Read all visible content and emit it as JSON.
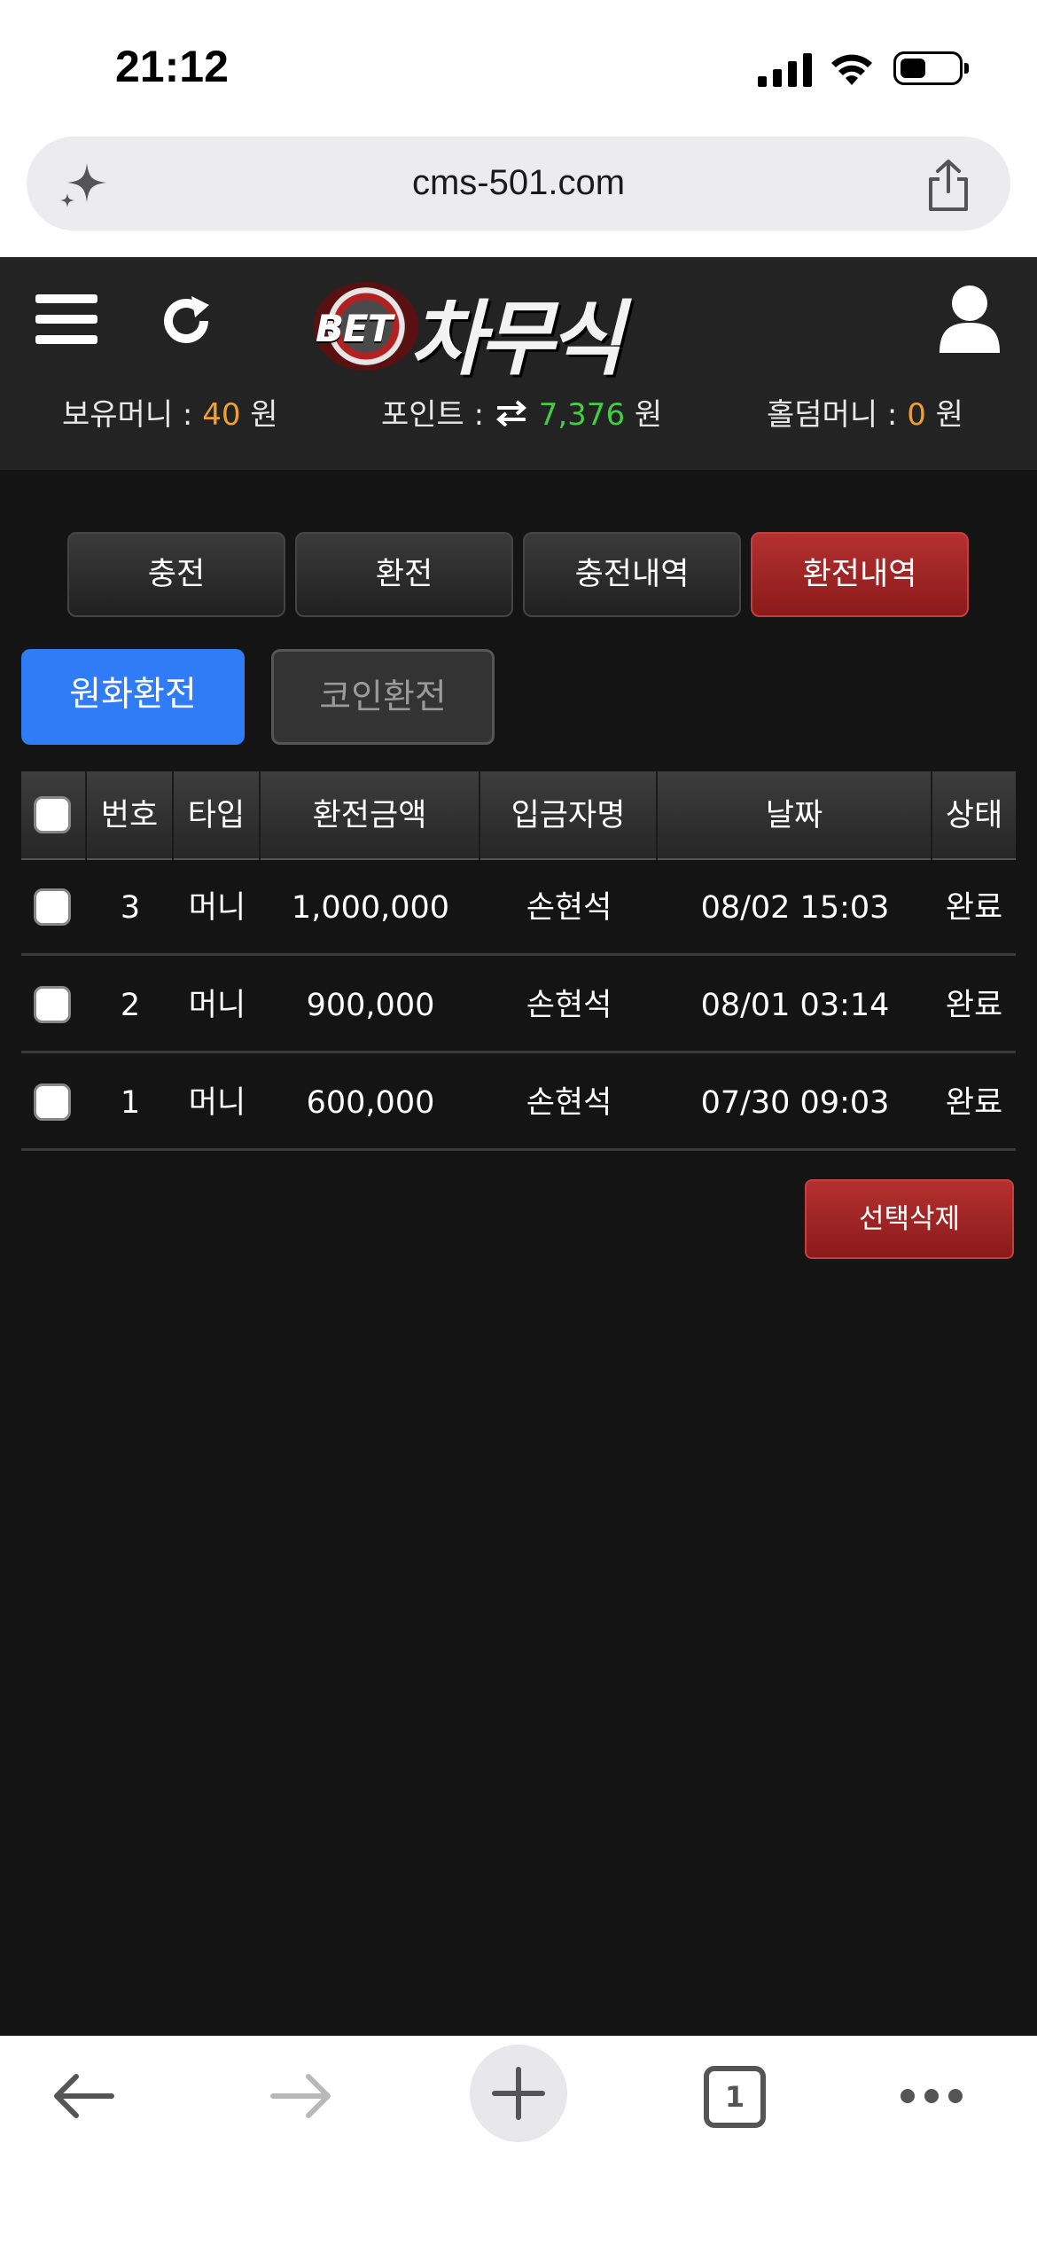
{
  "status_bar": {
    "time": "21:12"
  },
  "browser": {
    "url": "cms-501.com"
  },
  "header": {
    "logo_prefix": "BET",
    "logo_name": "차무식",
    "balances": {
      "money_label": "보유머니 :",
      "money_value": "40",
      "money_unit": "원",
      "point_label": "포인트 :",
      "point_value": "7,376",
      "point_unit": "원",
      "holdem_label": "홀덤머니 :",
      "holdem_value": "0",
      "holdem_unit": "원"
    }
  },
  "tabs": [
    {
      "label": "충전",
      "active": false
    },
    {
      "label": "환전",
      "active": false
    },
    {
      "label": "충전내역",
      "active": false
    },
    {
      "label": "환전내역",
      "active": true
    }
  ],
  "subtabs": [
    {
      "label": "원화환전",
      "selected": true
    },
    {
      "label": "코인환전",
      "selected": false
    }
  ],
  "table": {
    "columns": [
      "번호",
      "타입",
      "환전금액",
      "입금자명",
      "날짜",
      "상태"
    ],
    "rows": [
      {
        "no": "3",
        "type": "머니",
        "amount": "1,000,000",
        "depositor": "손현석",
        "date": "08/02 15:03",
        "status": "완료"
      },
      {
        "no": "2",
        "type": "머니",
        "amount": "900,000",
        "depositor": "손현석",
        "date": "08/01 03:14",
        "status": "완료"
      },
      {
        "no": "1",
        "type": "머니",
        "amount": "600,000",
        "depositor": "손현석",
        "date": "07/30 09:03",
        "status": "완료"
      }
    ]
  },
  "actions": {
    "delete_selected": "선택삭제"
  },
  "bottom_bar": {
    "tab_count": "1"
  },
  "colors": {
    "accent_blue": "#2f7cf6",
    "accent_red": "#a52424",
    "money_orange": "#f0a030",
    "point_green": "#44cc44"
  }
}
